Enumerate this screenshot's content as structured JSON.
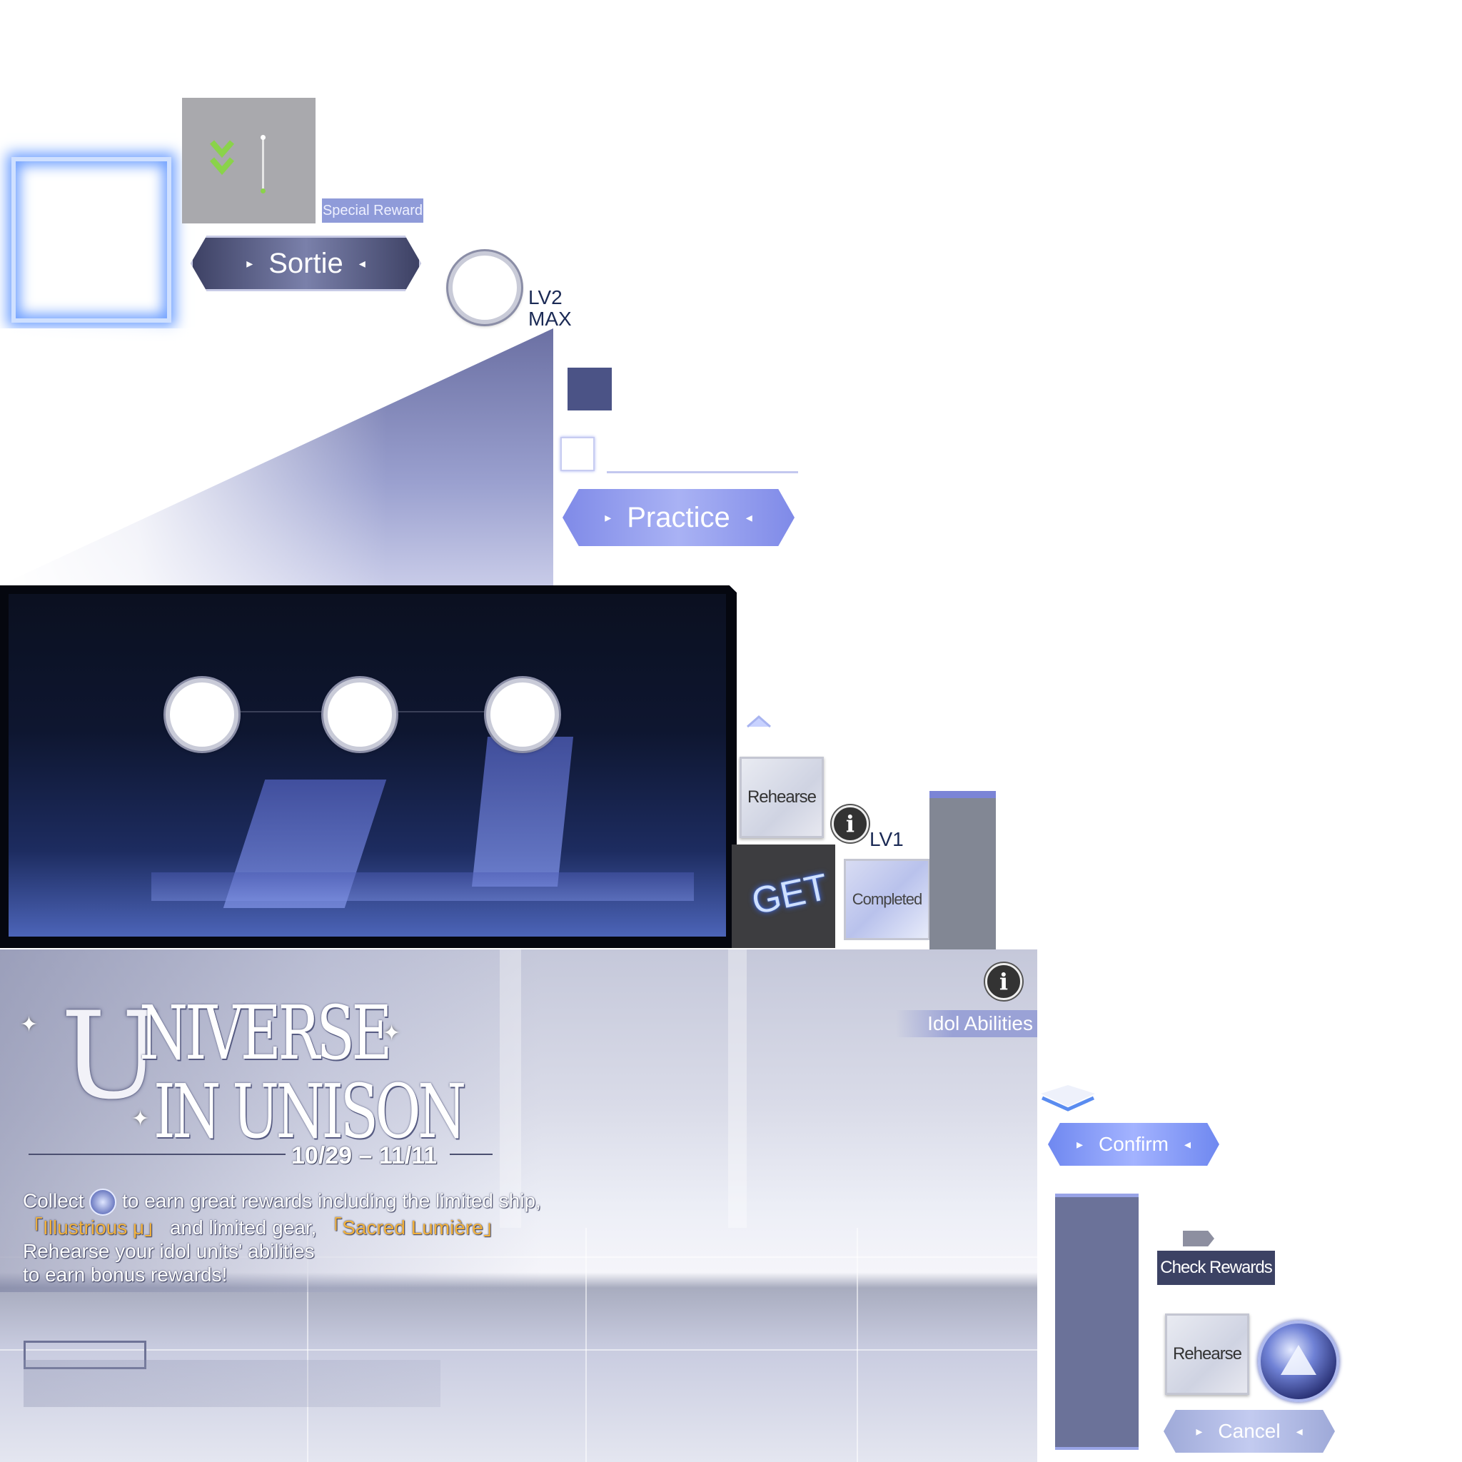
{
  "special_reward_label": "Special Reward",
  "sortie": {
    "label": "Sortie",
    "arrow_left": "▸",
    "arrow_right": "◂"
  },
  "level_badge_1": {
    "line1": "LV2",
    "line2": "MAX"
  },
  "practice": {
    "label": "Practice",
    "arrow_left": "▸",
    "arrow_right": "◂"
  },
  "rehearse_tile_1": "Rehearse",
  "info_glyph": "i",
  "level_badge_2": "LV1",
  "get_label": "GET",
  "completed_label": "Completed",
  "banner": {
    "title_initial": "U",
    "title_line1": "NIVERSE",
    "title_line2": "IN UNISON",
    "date_range": "10/29 – 11/11",
    "desc_collect": "Collect",
    "desc_after_icon": " to earn great rewards including the limited ship,",
    "desc_ship": "「Illustrious μ」",
    "desc_and_gear": " and limited gear, ",
    "desc_gear": "「Sacred Lumière」",
    "desc_line3": "Rehearse your idol units' abilities",
    "desc_line4": "to earn bonus rewards!",
    "idol_abilities": "Idol Abilities"
  },
  "confirm": {
    "label": "Confirm",
    "arrow_left": "▸",
    "arrow_right": "◂"
  },
  "check_rewards": "Check Rewards",
  "rehearse_tile_2": "Rehearse",
  "cancel": {
    "label": "Cancel",
    "arrow_left": "▸",
    "arrow_right": "◂"
  },
  "colors": {
    "accent_blue": "#7f8ae8",
    "dark_navy": "#3c4264",
    "highlight_gold": "#f2b23c",
    "chevron_green": "#8ad34a"
  }
}
